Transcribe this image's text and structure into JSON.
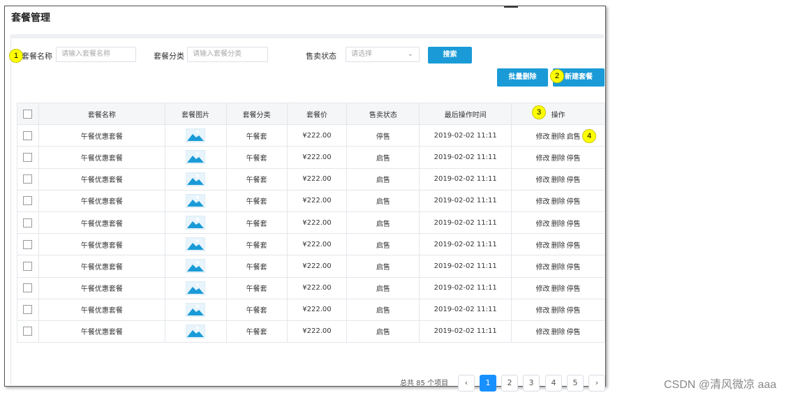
{
  "page_title": "套餐管理",
  "filters": {
    "name_label": "套餐名称",
    "name_placeholder": "请输入套餐名称",
    "category_label": "套餐分类",
    "category_placeholder": "请输入套餐分类",
    "status_label": "售卖状态",
    "status_placeholder": "请选择",
    "search_button": "搜索"
  },
  "toolbar": {
    "batch_delete": "批量删除",
    "new_combo": "新建套餐"
  },
  "markers": [
    "1",
    "2",
    "3",
    "4"
  ],
  "table": {
    "headers": [
      "套餐名称",
      "套餐图片",
      "套餐分类",
      "套餐价",
      "售卖状态",
      "最后操作时间",
      "操作"
    ],
    "rows": [
      {
        "name": "午餐优惠套餐",
        "category": "午餐套",
        "price": "¥222.00",
        "status": "停售",
        "time": "2019-02-02 11:11",
        "op_edit": "修改",
        "op_delete": "删除",
        "op_toggle": "启售"
      },
      {
        "name": "午餐优惠套餐",
        "category": "午餐套",
        "price": "¥222.00",
        "status": "启售",
        "time": "2019-02-02 11:11",
        "op_edit": "修改",
        "op_delete": "删除",
        "op_toggle": "停售"
      },
      {
        "name": "午餐优惠套餐",
        "category": "午餐套",
        "price": "¥222.00",
        "status": "启售",
        "time": "2019-02-02 11:11",
        "op_edit": "修改",
        "op_delete": "删除",
        "op_toggle": "停售"
      },
      {
        "name": "午餐优惠套餐",
        "category": "午餐套",
        "price": "¥222.00",
        "status": "启售",
        "time": "2019-02-02 11:11",
        "op_edit": "修改",
        "op_delete": "删除",
        "op_toggle": "停售"
      },
      {
        "name": "午餐优惠套餐",
        "category": "午餐套",
        "price": "¥222.00",
        "status": "启售",
        "time": "2019-02-02 11:11",
        "op_edit": "修改",
        "op_delete": "删除",
        "op_toggle": "停售"
      },
      {
        "name": "午餐优惠套餐",
        "category": "午餐套",
        "price": "¥222.00",
        "status": "启售",
        "time": "2019-02-02 11:11",
        "op_edit": "修改",
        "op_delete": "删除",
        "op_toggle": "停售"
      },
      {
        "name": "午餐优惠套餐",
        "category": "午餐套",
        "price": "¥222.00",
        "status": "启售",
        "time": "2019-02-02 11:11",
        "op_edit": "修改",
        "op_delete": "删除",
        "op_toggle": "停售"
      },
      {
        "name": "午餐优惠套餐",
        "category": "午餐套",
        "price": "¥222.00",
        "status": "启售",
        "time": "2019-02-02 11:11",
        "op_edit": "修改",
        "op_delete": "删除",
        "op_toggle": "停售"
      },
      {
        "name": "午餐优惠套餐",
        "category": "午餐套",
        "price": "¥222.00",
        "status": "启售",
        "time": "2019-02-02 11:11",
        "op_edit": "修改",
        "op_delete": "删除",
        "op_toggle": "停售"
      },
      {
        "name": "午餐优惠套餐",
        "category": "午餐套",
        "price": "¥222.00",
        "status": "启售",
        "time": "2019-02-02 11:11",
        "op_edit": "修改",
        "op_delete": "删除",
        "op_toggle": "停售"
      }
    ]
  },
  "pagination": {
    "total_text": "总共 85 个项目",
    "prev_icon": "‹",
    "next_icon": "›",
    "pages": [
      "1",
      "2",
      "3",
      "4",
      "5"
    ],
    "current": "1"
  },
  "watermark": "CSDN @清风微凉 aaa",
  "colors": {
    "primary": "#1a9bd7",
    "active_page": "#1890ff",
    "marker": "#ffff00",
    "image_icon": "#1a9bd7"
  },
  "icons": {
    "image": "image-placeholder-icon",
    "dropdown": "chevron-down-icon"
  }
}
